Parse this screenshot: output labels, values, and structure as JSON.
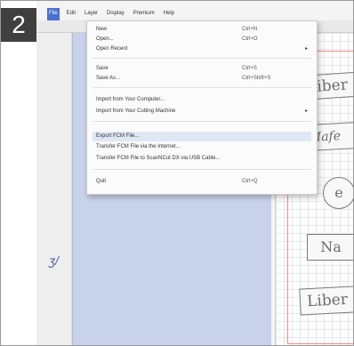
{
  "step": "2",
  "menubar": [
    "File",
    "Edit",
    "Layer",
    "Display",
    "Premium",
    "Help"
  ],
  "file_menu": [
    {
      "label": "New",
      "shortcut": "Ctrl+N"
    },
    {
      "label": "Open...",
      "shortcut": "Ctrl+O"
    },
    {
      "label": "Open Recent",
      "shortcut": "",
      "submenu": true
    },
    {
      "label": "Save",
      "shortcut": "Ctrl+S"
    },
    {
      "label": "Save As...",
      "shortcut": "Ctrl+Shift+S"
    },
    {
      "label": "Import from Your Computer...",
      "shortcut": ""
    },
    {
      "label": "Import from Your Cutting Machine",
      "shortcut": "",
      "submenu": true
    },
    {
      "label": "Export FCM File...",
      "shortcut": ""
    },
    {
      "label": "Transfer FCM File via the Internet...",
      "shortcut": ""
    },
    {
      "label": "Transfer FCM File to ScanNCut DX via USB Cable...",
      "shortcut": ""
    },
    {
      "label": "Quit",
      "shortcut": "Ctrl+Q"
    }
  ],
  "highlighted_item": "Export FCM File...",
  "left_panel_glyph": "ʒ/",
  "canvas_plaques": [
    "Liber",
    "Mafe",
    "e",
    "Na",
    "Liber"
  ],
  "colors": {
    "menu_highlight": "#dfe7f5",
    "menubar_active": "#4b6fd1",
    "work_area": "#c8d2ea",
    "canvas_border": "#f08a8a"
  }
}
